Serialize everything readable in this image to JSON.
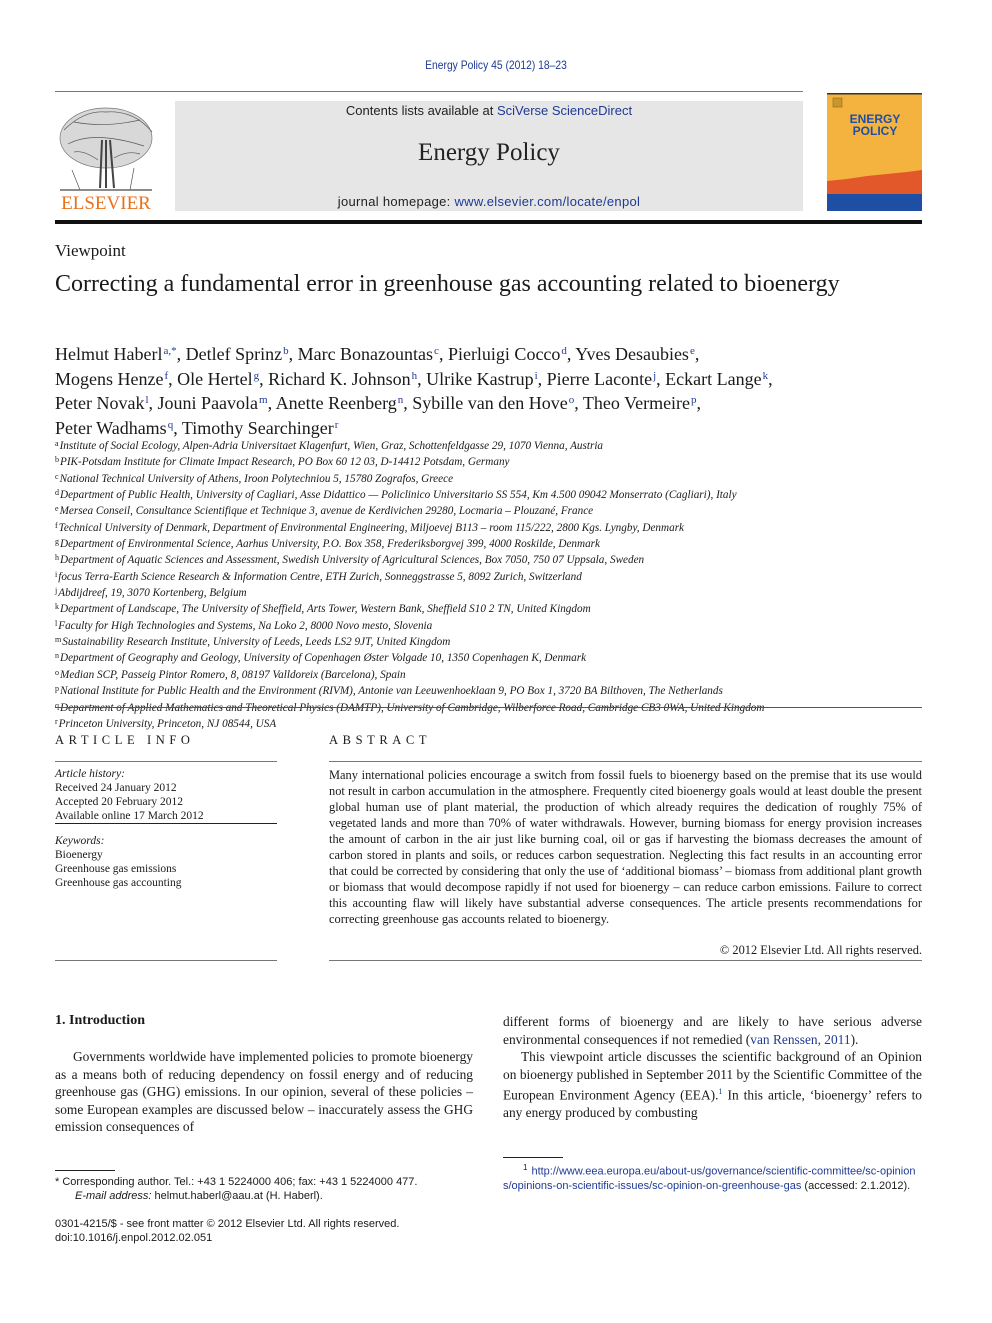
{
  "header": {
    "citation": "Energy Policy 45 (2012) 18–23",
    "contents_prefix": "Contents lists available at ",
    "contents_link": "SciVerse ScienceDirect",
    "journal_title": "Energy Policy",
    "homepage_prefix": "journal homepage: ",
    "homepage_link": "www.elsevier.com/locate/enpol",
    "publisher_logo_text": "ELSEVIER",
    "cover_title_line1": "ENERGY",
    "cover_title_line2": "POLICY",
    "colors": {
      "link": "#1f3a93",
      "elsevier_orange": "#e9711c",
      "cover_yellow": "#f4b33f",
      "cover_orange": "#e2582a",
      "cover_blue": "#1f4fa5",
      "banner_grey": "#e6e6e6"
    }
  },
  "article": {
    "section_type": "Viewpoint",
    "title": "Correcting a fundamental error in greenhouse gas accounting related to bioenergy",
    "authors": [
      {
        "name": "Helmut Haberl",
        "sup": "a,*",
        "sep": ", "
      },
      {
        "name": "Detlef Sprinz",
        "sup": "b",
        "sep": ", "
      },
      {
        "name": "Marc Bonazountas",
        "sup": "c",
        "sep": ", "
      },
      {
        "name": "Pierluigi Cocco",
        "sup": "d",
        "sep": ", "
      },
      {
        "name": "Yves Desaubies",
        "sup": "e",
        "sep": ", "
      },
      {
        "name": "Mogens Henze",
        "sup": "f",
        "sep": ", "
      },
      {
        "name": "Ole Hertel",
        "sup": "g",
        "sep": ", "
      },
      {
        "name": "Richard K. Johnson",
        "sup": "h",
        "sep": ", "
      },
      {
        "name": "Ulrike Kastrup",
        "sup": "i",
        "sep": ", "
      },
      {
        "name": "Pierre Laconte",
        "sup": "j",
        "sep": ", "
      },
      {
        "name": "Eckart Lange",
        "sup": "k",
        "sep": ", "
      },
      {
        "name": "Peter Novak",
        "sup": "l",
        "sep": ", "
      },
      {
        "name": "Jouni Paavola",
        "sup": "m",
        "sep": ", "
      },
      {
        "name": "Anette Reenberg",
        "sup": "n",
        "sep": ", "
      },
      {
        "name": "Sybille van den Hove",
        "sup": "o",
        "sep": ", "
      },
      {
        "name": "Theo Vermeire",
        "sup": "p",
        "sep": ", "
      },
      {
        "name": "Peter Wadhams",
        "sup": "q",
        "sep": ", "
      },
      {
        "name": "Timothy Searchinger",
        "sup": "r",
        "sep": ""
      }
    ],
    "affiliations": [
      {
        "key": "a",
        "text": "Institute of Social Ecology, Alpen-Adria Universitaet Klagenfurt, Wien, Graz, Schottenfeldgasse 29, 1070 Vienna, Austria"
      },
      {
        "key": "b",
        "text": "PIK-Potsdam Institute for Climate Impact Research, PO Box 60 12 03, D-14412 Potsdam, Germany"
      },
      {
        "key": "c",
        "text": "National Technical University of Athens, Iroon Polytechniou 5, 15780 Zografos, Greece"
      },
      {
        "key": "d",
        "text": "Department of Public Health, University of Cagliari, Asse Didattico — Policlinico Universitario SS 554, Km 4.500 09042 Monserrato (Cagliari), Italy"
      },
      {
        "key": "e",
        "text": "Mersea Conseil, Consultance Scientifique et Technique 3, avenue de Kerdivichen 29280, Locmaria – Plouzané, France"
      },
      {
        "key": "f",
        "text": "Technical University of Denmark, Department of Environmental Engineering, Miljoevej B113 – room 115/222, 2800 Kgs. Lyngby, Denmark"
      },
      {
        "key": "g",
        "text": "Department of Environmental Science, Aarhus University, P.O. Box 358, Frederiksborgvej 399, 4000 Roskilde, Denmark"
      },
      {
        "key": "h",
        "text": "Department of Aquatic Sciences and Assessment, Swedish University of Agricultural Sciences, Box 7050, 750 07 Uppsala, Sweden"
      },
      {
        "key": "i",
        "text": "focus Terra-Earth Science Research & Information Centre, ETH Zurich, Sonneggstrasse 5, 8092 Zurich, Switzerland"
      },
      {
        "key": "j",
        "text": "Abdijdreef, 19, 3070 Kortenberg, Belgium"
      },
      {
        "key": "k",
        "text": "Department of Landscape, The University of Sheffield, Arts Tower, Western Bank, Sheffield S10 2 TN, United Kingdom"
      },
      {
        "key": "l",
        "text": "Faculty for High Technologies and Systems, Na Loko 2, 8000 Novo mesto, Slovenia"
      },
      {
        "key": "m",
        "text": "Sustainability Research Institute, University of Leeds, Leeds LS2 9JT, United Kingdom"
      },
      {
        "key": "n",
        "text": "Department of Geography and Geology, University of Copenhagen Øster Volgade 10, 1350 Copenhagen K, Denmark"
      },
      {
        "key": "o",
        "text": "Median SCP, Passeig Pintor Romero, 8, 08197 Valldoreix (Barcelona), Spain"
      },
      {
        "key": "p",
        "text": "National Institute for Public Health and the Environment (RIVM), Antonie van Leeuwenhoeklaan 9, PO Box 1, 3720 BA Bilthoven, The Netherlands"
      },
      {
        "key": "q",
        "text": "Department of Applied Mathematics and Theoretical Physics (DAMTP), University of Cambridge, Wilberforce Road, Cambridge CB3 0WA, United Kingdom"
      },
      {
        "key": "r",
        "text": "Princeton University, Princeton, NJ 08544, USA"
      }
    ]
  },
  "article_info": {
    "heading": "ARTICLE INFO",
    "history_label": "Article history:",
    "received": "Received 24 January 2012",
    "accepted": "Accepted 20 February 2012",
    "online": "Available online 17 March 2012",
    "keywords_label": "Keywords:",
    "keywords": [
      "Bioenergy",
      "Greenhouse gas emissions",
      "Greenhouse gas accounting"
    ]
  },
  "abstract": {
    "heading": "ABSTRACT",
    "text": "Many international policies encourage a switch from fossil fuels to bioenergy based on the premise that its use would not result in carbon accumulation in the atmosphere. Frequently cited bioenergy goals would at least double the present global human use of plant material, the production of which already requires the dedication of roughly 75% of vegetated lands and more than 70% of water withdrawals. However, burning biomass for energy provision increases the amount of carbon in the air just like burning coal, oil or gas if harvesting the biomass decreases the amount of carbon stored in plants and soils, or reduces carbon sequestration. Neglecting this fact results in an accounting error that could be corrected by considering that only the use of ‘additional biomass’ – biomass from additional plant growth or biomass that would decompose rapidly if not used for bioenergy – can reduce carbon emissions. Failure to correct this accounting flaw will likely have substantial adverse consequences. The article presents recommendations for correcting greenhouse gas accounts related to bioenergy.",
    "copyright": "© 2012 Elsevier Ltd. All rights reserved."
  },
  "body": {
    "intro_heading": "1.  Introduction",
    "col1_para1": "Governments worldwide have implemented policies to promote bioenergy as a means both of reducing dependency on fossil energy and of reducing greenhouse gas (GHG) emissions. In our opinion, several of these policies – some European examples are discussed below – inaccurately assess the GHG emission consequences of",
    "col2_para1_text": "different forms of bioenergy and are likely to have serious adverse environmental consequences if not remedied (",
    "col2_para1_link": "van Renssen, 2011",
    "col2_para1_end": ").",
    "col2_para2_text": "This viewpoint article discusses the scientific background of an Opinion on bioenergy published in September 2011 by the Scientific Committee of the European Environment Agency (EEA).",
    "col2_para2_sup": "1",
    "col2_para2_end": " In this article, ‘bioenergy’ refers to any energy produced by combusting"
  },
  "footnotes": {
    "corresponding": "* Corresponding author. Tel.: +43 1 5224000 406; fax: +43 1 5224000 477.",
    "email_label": "E-mail address:",
    "email_value": " helmut.haberl@aau.at (H. Haberl).",
    "fn1_mark": "1",
    "fn1_link": "http://www.eea.europa.eu/about-us/governance/scientific-committee/sc-opinions/opinions-on-scientific-issues/sc-opinion-on-greenhouse-gas",
    "fn1_accessed": " (accessed: 2.1.2012).",
    "issn": "0301-4215/$ - see front matter © 2012 Elsevier Ltd. All rights reserved.",
    "doi": "doi:10.1016/j.enpol.2012.02.051"
  }
}
